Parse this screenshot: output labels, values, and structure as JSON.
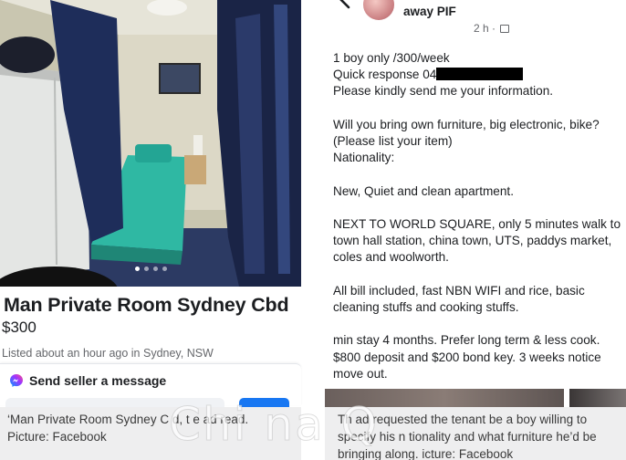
{
  "listing": {
    "photo_dots": 4,
    "active_dot": 0,
    "title": "Man Private Room Sydney Cbd",
    "price": "$300",
    "meta": "Listed about an hour ago in Sydney, NSW",
    "message_label": "Send seller a message"
  },
  "left_caption": {
    "line1": "‘Man Private Room Sydney C   d,  t  e ad read.",
    "line2": "Picture: Facebook"
  },
  "post": {
    "poster_name": "away PIF",
    "time": "2 h ·",
    "lines": [
      "1 boy only /300/week",
      "Quick response 04",
      "Please kindly send me your information.",
      "",
      "Will you bring own furniture, big electronic, bike?",
      "(Please list your item)",
      "Nationality:",
      "",
      "New, Quiet and clean apartment.",
      "",
      "NEXT TO WORLD SQUARE, only 5 minutes walk to",
      "town hall station, china town, UTS, paddys market,",
      "coles and woolworth.",
      "",
      "All bill included, fast NBN WIFI and rice, basic",
      "cleaning stuffs and cooking stuffs.",
      "",
      "min stay 4 months. Prefer long term & less cook.",
      "$800 deposit and $200 bond key. 3 weeks notice",
      "move out."
    ]
  },
  "right_caption": {
    "line1": "Th   ad requested the tenant be a boy willing to",
    "line2": "specify his n  tionality and what furniture he’d be",
    "line3": "bringing along.  icture: Facebook"
  },
  "watermark": "Chi  na  Q"
}
